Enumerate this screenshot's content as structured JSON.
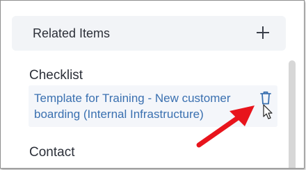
{
  "related_items": {
    "title": "Related Items",
    "add_icon": "plus-icon"
  },
  "sections": {
    "checklist": {
      "label": "Checklist",
      "item": {
        "text": "Template for Training - New customer boarding (Internal Infrastructure)",
        "delete_icon": "trash-icon"
      }
    },
    "contact": {
      "label": "Contact"
    }
  },
  "colors": {
    "link": "#3a70b0",
    "header_bg": "#f2f4f7",
    "card_bg": "#f4f6fa",
    "annotation_arrow": "#e8141c"
  }
}
